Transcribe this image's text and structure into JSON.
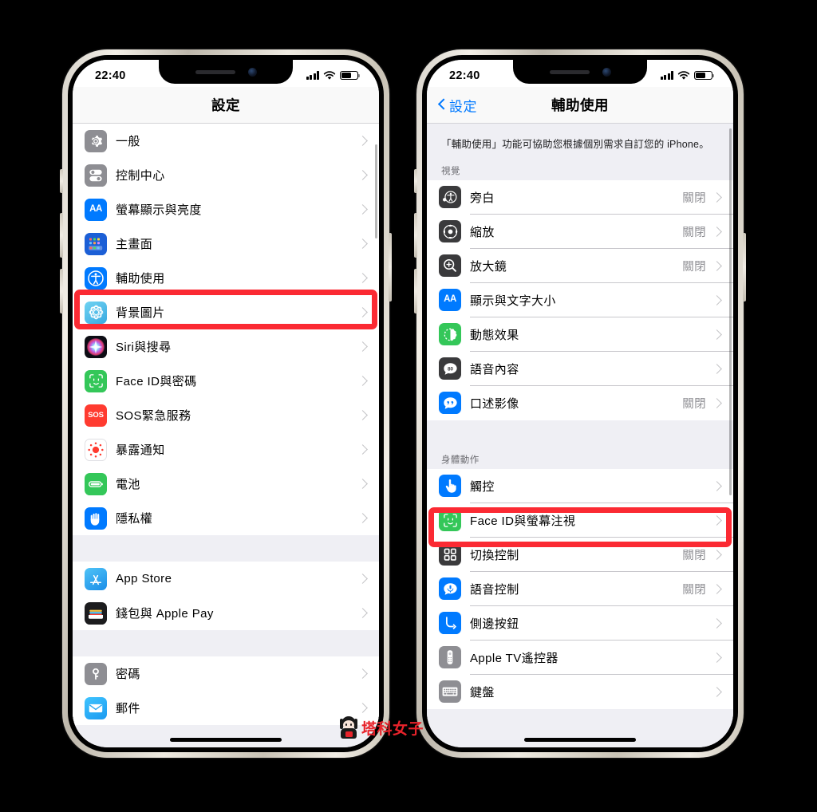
{
  "watermark": {
    "text": "塔科女子"
  },
  "phone_left": {
    "status": {
      "time": "22:40",
      "signal_bars": 4,
      "battery_level": 62
    },
    "nav": {
      "title": "設定"
    },
    "scrollbar": {
      "top_pct": 8,
      "height_pct": 14
    },
    "groups": [
      {
        "items": [
          {
            "label": "一般",
            "icon": "gear-icon",
            "value": ""
          },
          {
            "label": "控制中心",
            "icon": "control-center-icon",
            "value": ""
          },
          {
            "label": "螢幕顯示與亮度",
            "icon": "display-brightness-icon",
            "value": ""
          },
          {
            "label": "主畫面",
            "icon": "home-screen-icon",
            "value": ""
          },
          {
            "label": "輔助使用",
            "icon": "accessibility-icon",
            "value": "",
            "highlighted": true
          },
          {
            "label": "背景圖片",
            "icon": "wallpaper-icon",
            "value": ""
          },
          {
            "label": "Siri與搜尋",
            "icon": "siri-icon",
            "value": ""
          },
          {
            "label": "Face ID與密碼",
            "icon": "faceid-icon",
            "value": ""
          },
          {
            "label": "SOS緊急服務",
            "icon": "sos-icon",
            "value": ""
          },
          {
            "label": "暴露通知",
            "icon": "exposure-notification-icon",
            "value": ""
          },
          {
            "label": "電池",
            "icon": "battery-icon",
            "value": ""
          },
          {
            "label": "隱私權",
            "icon": "privacy-hand-icon",
            "value": ""
          }
        ]
      },
      {
        "items": [
          {
            "label": "App Store",
            "icon": "app-store-icon",
            "value": ""
          },
          {
            "label": "錢包與 Apple Pay",
            "icon": "wallet-icon",
            "value": ""
          }
        ]
      },
      {
        "items": [
          {
            "label": "密碼",
            "icon": "passwords-key-icon",
            "value": ""
          },
          {
            "label": "郵件",
            "icon": "mail-icon",
            "value": ""
          }
        ]
      }
    ]
  },
  "phone_right": {
    "status": {
      "time": "22:40",
      "signal_bars": 4,
      "battery_level": 62
    },
    "nav": {
      "title": "輔助使用",
      "back_label": "設定"
    },
    "intro": "「輔助使用」功能可協助您根據個別需求自訂您的 iPhone。",
    "scrollbar": {
      "top_pct": 2,
      "height_pct": 62
    },
    "sections": [
      {
        "header": "視覺",
        "items": [
          {
            "label": "旁白",
            "icon": "voiceover-icon",
            "value": "關閉"
          },
          {
            "label": "縮放",
            "icon": "zoom-icon",
            "value": "關閉"
          },
          {
            "label": "放大鏡",
            "icon": "magnifier-icon",
            "value": "關閉"
          },
          {
            "label": "顯示與文字大小",
            "icon": "display-text-size-icon",
            "value": ""
          },
          {
            "label": "動態效果",
            "icon": "motion-icon",
            "value": ""
          },
          {
            "label": "語音內容",
            "icon": "spoken-content-icon",
            "value": ""
          },
          {
            "label": "口述影像",
            "icon": "audio-descriptions-icon",
            "value": "關閉"
          }
        ]
      },
      {
        "header": "身體動作",
        "items": [
          {
            "label": "觸控",
            "icon": "touch-icon",
            "value": "",
            "highlighted": true
          },
          {
            "label": "Face ID與螢幕注視",
            "icon": "faceid-attention-icon",
            "value": ""
          },
          {
            "label": "切換控制",
            "icon": "switch-control-icon",
            "value": "關閉"
          },
          {
            "label": "語音控制",
            "icon": "voice-control-icon",
            "value": "關閉"
          },
          {
            "label": "側邊按鈕",
            "icon": "side-button-icon",
            "value": ""
          },
          {
            "label": "Apple TV遙控器",
            "icon": "apple-tv-remote-icon",
            "value": ""
          },
          {
            "label": "鍵盤",
            "icon": "keyboard-icon",
            "value": ""
          }
        ]
      }
    ]
  },
  "colors": {
    "highlight_red": "#fb2a33",
    "accent_blue": "#027aff",
    "value_gray": "#8e8e93",
    "group_bg": "#efeff4"
  }
}
